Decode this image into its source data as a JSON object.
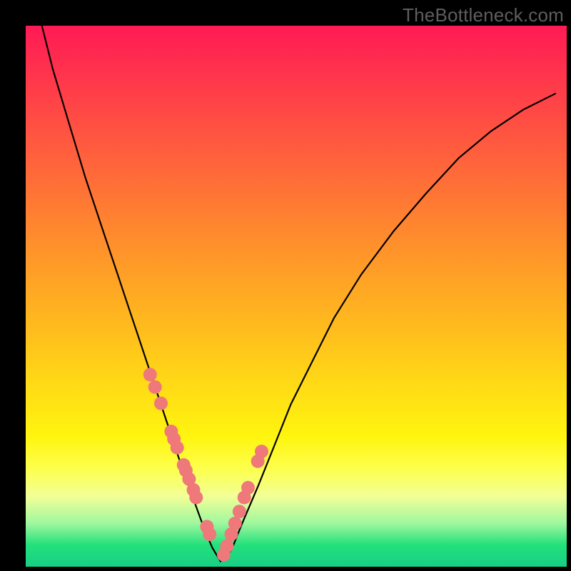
{
  "watermark": "TheBottleneck.com",
  "chart_data": {
    "type": "line",
    "title": "",
    "xlabel": "",
    "ylabel": "",
    "xlim": [
      0,
      100
    ],
    "ylim": [
      0,
      100
    ],
    "series": [
      {
        "name": "bottleneck-curve",
        "x": [
          3,
          5,
          8,
          11,
          14,
          17,
          19,
          21,
          23,
          25,
          27,
          29,
          31,
          33,
          34.5,
          36,
          38,
          40,
          43,
          46,
          49,
          53,
          57,
          62,
          68,
          74,
          80,
          86,
          92,
          98
        ],
        "values": [
          100,
          92,
          82,
          72,
          63,
          54,
          48,
          42,
          36,
          30,
          24,
          18,
          12.5,
          7,
          3.5,
          1,
          3,
          8,
          15,
          22.5,
          30,
          38,
          46,
          54,
          62,
          69,
          75.5,
          80.5,
          84.5,
          87.5
        ]
      },
      {
        "name": "scatter-dots",
        "x": [
          23.0,
          23.9,
          25.0,
          26.9,
          27.4,
          28.0,
          29.2,
          29.6,
          30.2,
          31.0,
          31.5,
          33.5,
          34.0,
          36.6,
          37.2,
          38.0,
          38.7,
          39.5,
          40.4,
          41.1,
          42.9,
          43.6
        ],
        "values": [
          35.5,
          33.2,
          30.2,
          25.0,
          23.6,
          22.0,
          18.8,
          17.8,
          16.2,
          14.2,
          12.8,
          7.4,
          6.0,
          2.2,
          3.8,
          6.0,
          8.0,
          10.2,
          12.8,
          14.6,
          19.5,
          21.3
        ]
      }
    ],
    "colors": {
      "curve": "#000000",
      "dots": "#ee787a",
      "gradient_top": "#ff1a55",
      "gradient_bottom": "#17cf86"
    }
  }
}
